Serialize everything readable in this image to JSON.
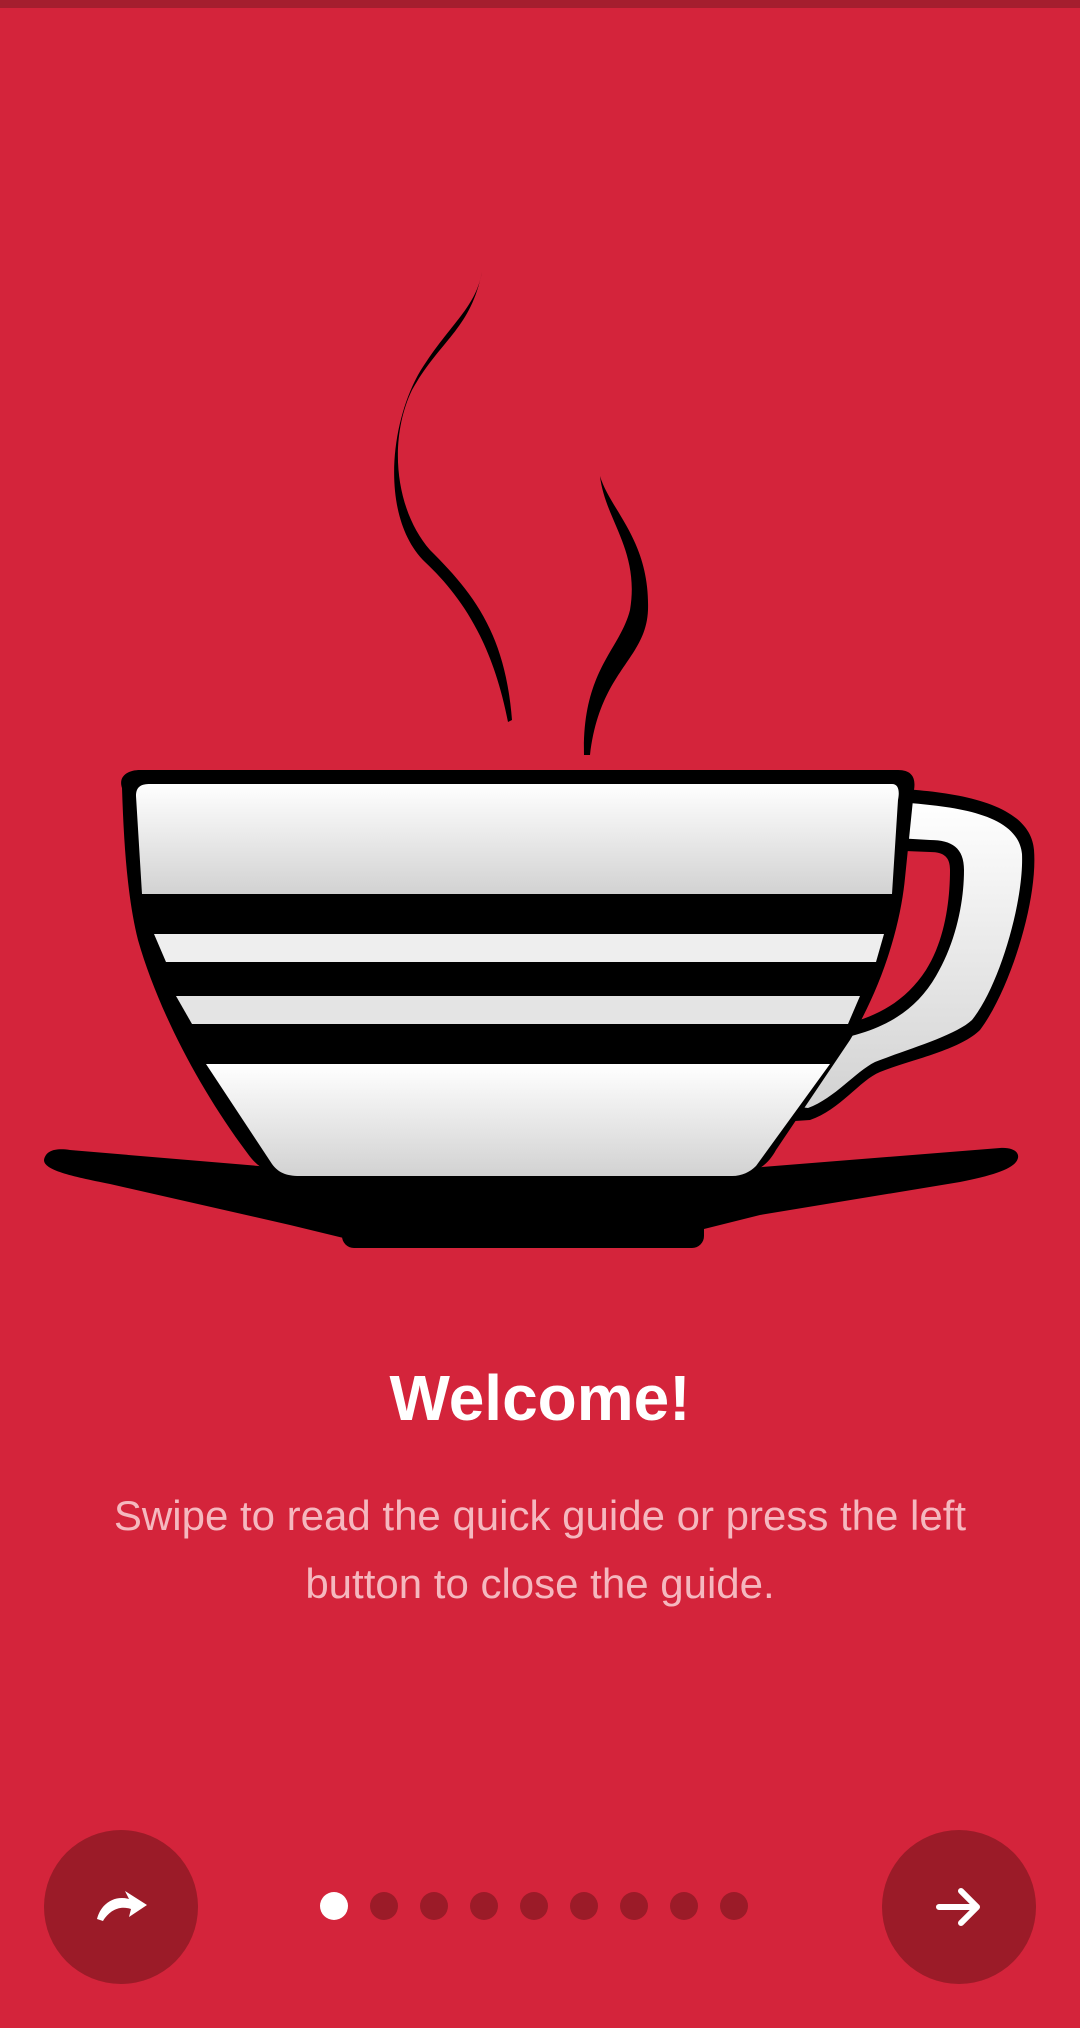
{
  "colors": {
    "background": "#d4243b",
    "button_background": "#9b1b28",
    "title_text": "#ffffff",
    "description_text": "#f5b8bf",
    "dot_inactive": "#9b1b28",
    "dot_active": "#ffffff"
  },
  "illustration": {
    "icon": "coffee-cup-icon"
  },
  "onboarding": {
    "title": "Welcome!",
    "description": "Swipe to read the quick guide or press the left button to close the guide."
  },
  "controls": {
    "skip_icon": "redo-arrow-icon",
    "next_icon": "arrow-right-icon",
    "page_count": 9,
    "current_page": 1
  }
}
